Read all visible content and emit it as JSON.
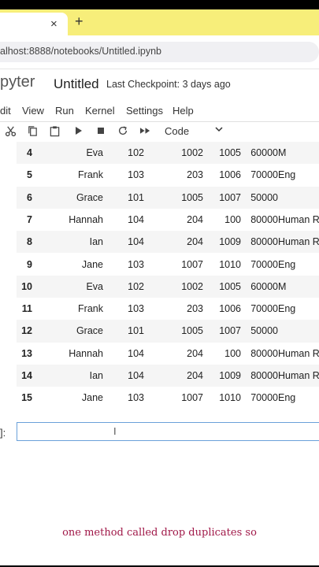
{
  "browser": {
    "tab_close": "×",
    "new_tab": "+",
    "url": "alhost:8888/notebooks/Untitled.ipynb"
  },
  "jupyter": {
    "logo": "pyter",
    "notebook_title": "Untitled",
    "checkpoint": "Last Checkpoint: 3 days ago"
  },
  "menu": [
    "dit",
    "View",
    "Run",
    "Kernel",
    "Settings",
    "Help"
  ],
  "toolbar": {
    "cell_type": "Code",
    "icons": [
      "scissors-icon",
      "copy-icon",
      "paste-icon",
      "run-icon",
      "stop-icon",
      "restart-icon",
      "fast-forward-icon",
      "chevron-down-icon"
    ]
  },
  "table": {
    "rows": [
      {
        "idx": "4",
        "name": "Eva",
        "dept": "102",
        "a": "1002",
        "b": "1005",
        "salary": "60000",
        "role": "M"
      },
      {
        "idx": "5",
        "name": "Frank",
        "dept": "103",
        "a": "203",
        "b": "1006",
        "salary": "70000",
        "role": "Eng"
      },
      {
        "idx": "6",
        "name": "Grace",
        "dept": "101",
        "a": "1005",
        "b": "1007",
        "salary": "50000",
        "role": ""
      },
      {
        "idx": "7",
        "name": "Hannah",
        "dept": "104",
        "a": "204",
        "b": "100",
        "salary": "80000",
        "role": "Human Re"
      },
      {
        "idx": "8",
        "name": "Ian",
        "dept": "104",
        "a": "204",
        "b": "1009",
        "salary": "80000",
        "role": "Human Re"
      },
      {
        "idx": "9",
        "name": "Jane",
        "dept": "103",
        "a": "1007",
        "b": "1010",
        "salary": "70000",
        "role": "Eng"
      },
      {
        "idx": "10",
        "name": "Eva",
        "dept": "102",
        "a": "1002",
        "b": "1005",
        "salary": "60000",
        "role": "M"
      },
      {
        "idx": "11",
        "name": "Frank",
        "dept": "103",
        "a": "203",
        "b": "1006",
        "salary": "70000",
        "role": "Eng"
      },
      {
        "idx": "12",
        "name": "Grace",
        "dept": "101",
        "a": "1005",
        "b": "1007",
        "salary": "50000",
        "role": ""
      },
      {
        "idx": "13",
        "name": "Hannah",
        "dept": "104",
        "a": "204",
        "b": "100",
        "salary": "80000",
        "role": "Human Re"
      },
      {
        "idx": "14",
        "name": "Ian",
        "dept": "104",
        "a": "204",
        "b": "1009",
        "salary": "80000",
        "role": "Human Re"
      },
      {
        "idx": "15",
        "name": "Jane",
        "dept": "103",
        "a": "1007",
        "b": "1010",
        "salary": "70000",
        "role": "Eng"
      }
    ]
  },
  "cell": {
    "prompt": "]:",
    "cursor": "I"
  },
  "caption": "one method called drop duplicates so"
}
